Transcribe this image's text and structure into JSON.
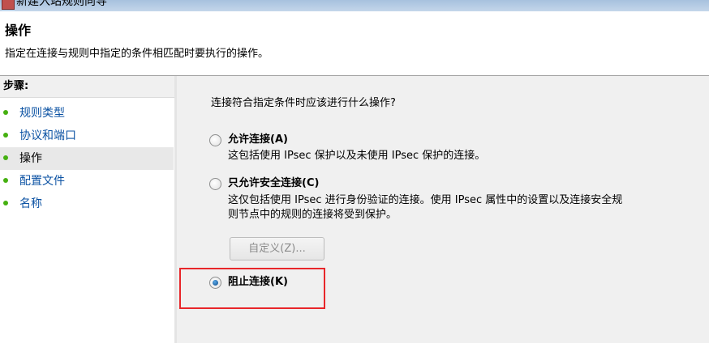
{
  "window": {
    "title": "新建入站规则向导"
  },
  "header": {
    "title": "操作",
    "description": "指定在连接与规则中指定的条件相匹配时要执行的操作。"
  },
  "steps": {
    "title": "步骤:",
    "items": [
      {
        "label": "规则类型"
      },
      {
        "label": "协议和端口"
      },
      {
        "label": "操作",
        "current": true
      },
      {
        "label": "配置文件"
      },
      {
        "label": "名称"
      }
    ]
  },
  "content": {
    "question": "连接符合指定条件时应该进行什么操作?",
    "options": [
      {
        "label": "允许连接(A)",
        "description": "这包括使用 IPsec 保护以及未使用 IPsec 保护的连接。",
        "selected": false
      },
      {
        "label": "只允许安全连接(C)",
        "description_line1": "这仅包括使用 IPsec 进行身份验证的连接。使用 IPsec 属性中的设置以及连接安全规",
        "description_line2": "则节点中的规则的连接将受到保护。",
        "selected": false
      },
      {
        "label": "阻止连接(K)",
        "selected": true
      }
    ],
    "customize_label": "自定义(Z)..."
  },
  "colors": {
    "link": "#0b52a3",
    "bullet": "#45b010",
    "highlight": "#e8262a",
    "panel_bg": "#f0f0f0"
  }
}
